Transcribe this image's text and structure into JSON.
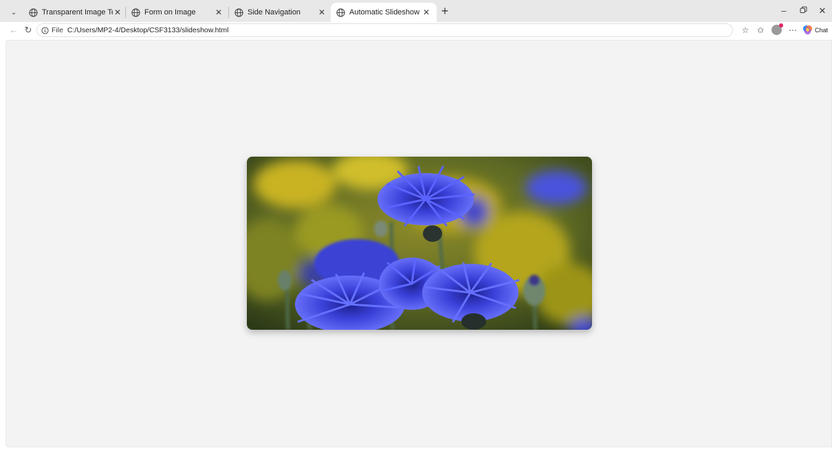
{
  "tabs": [
    {
      "label": "Transparent Image Text",
      "active": false
    },
    {
      "label": "Form on Image",
      "active": false
    },
    {
      "label": "Side Navigation",
      "active": false
    },
    {
      "label": "Automatic Slideshow",
      "active": true
    }
  ],
  "address": {
    "scheme_label": "File",
    "url": "C:/Users/MP2-4/Desktop/CSF3133/slideshow.html"
  },
  "toolbar": {
    "copilot_label": "Chat"
  },
  "slideshow": {
    "image_subject": "blue cornflowers"
  },
  "colors": {
    "tabstrip": "#e8e8e8",
    "page_background": "#f3f3f3",
    "flower_blue": "#3c46e6",
    "background_yellow": "#c8b41e"
  }
}
